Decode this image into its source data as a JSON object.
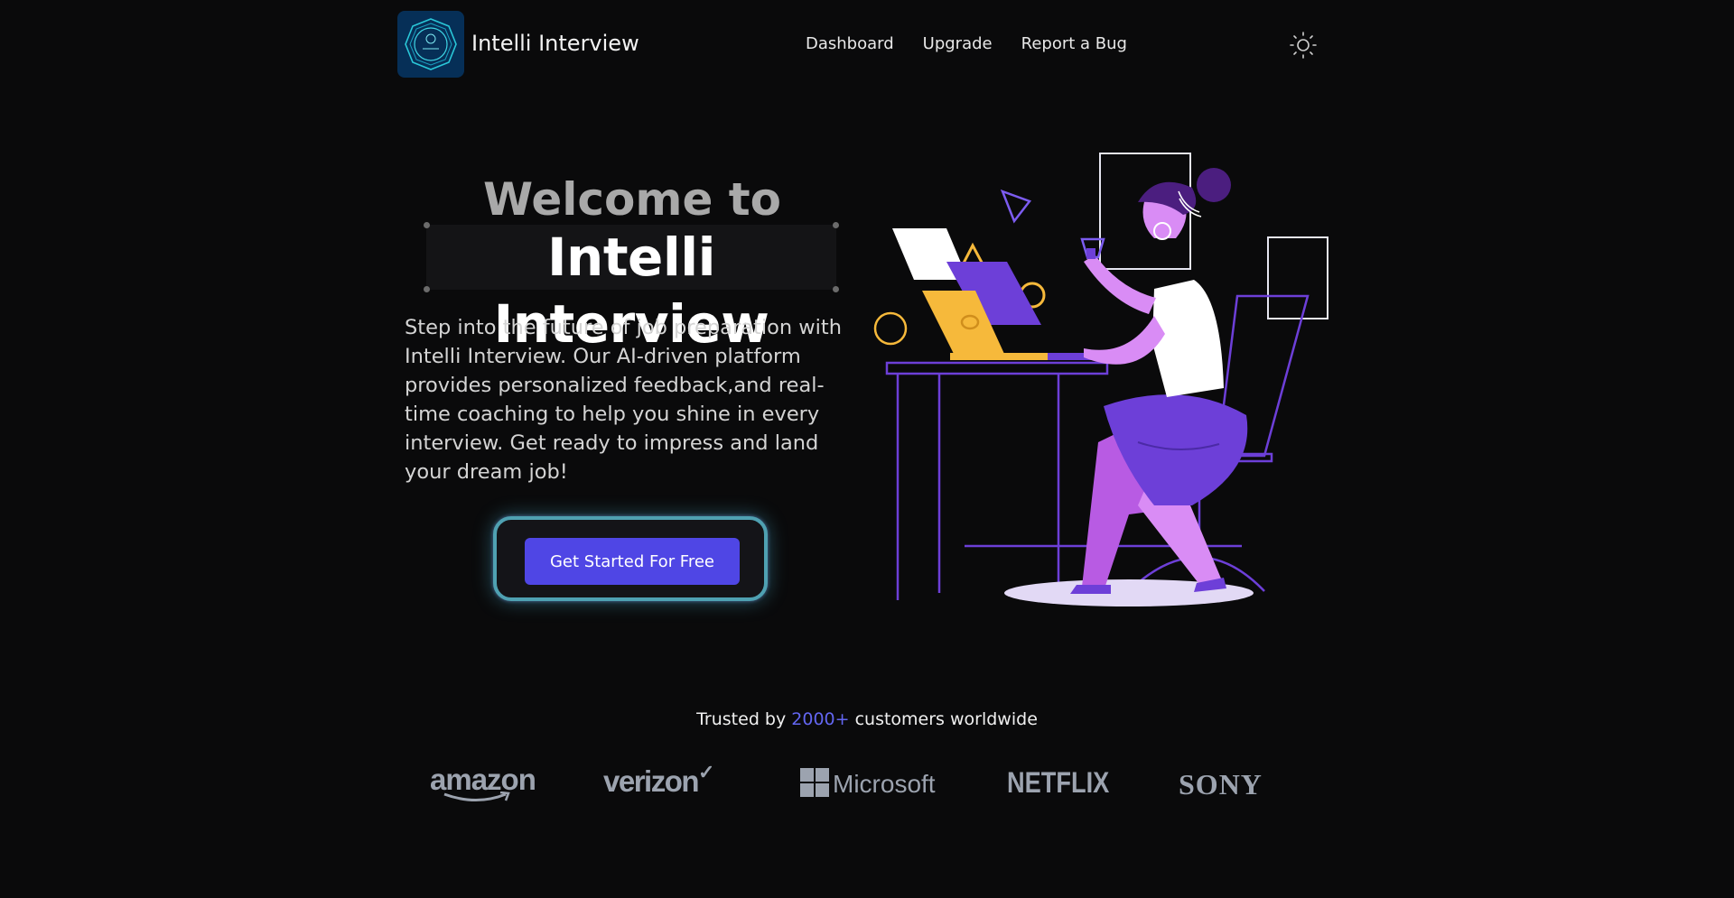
{
  "header": {
    "brand": "Intelli Interview",
    "nav": [
      "Dashboard",
      "Upgrade",
      "Report a Bug"
    ]
  },
  "hero": {
    "welcome": "Welcome to",
    "title": "Intelli Interview",
    "intro": "Step into the future of job preparation with Intelli Interview. Our AI-driven platform provides personalized feedback,and real-time coaching to help you shine in every interview. Get ready to impress and land your dream job!",
    "cta_label": "Get Started For Free"
  },
  "trusted": {
    "prefix": "Trusted by ",
    "highlight": "2000+",
    "suffix": " customers worldwide",
    "logos": [
      "amazon",
      "verizon",
      "Microsoft",
      "NETFLIX",
      "SONY"
    ]
  },
  "colors": {
    "background": "#0a0a0b",
    "accent": "#4f46e5",
    "highlight": "#6366f1",
    "illustration_purple": "#c56ef0",
    "illustration_yellow": "#f6b93b"
  }
}
